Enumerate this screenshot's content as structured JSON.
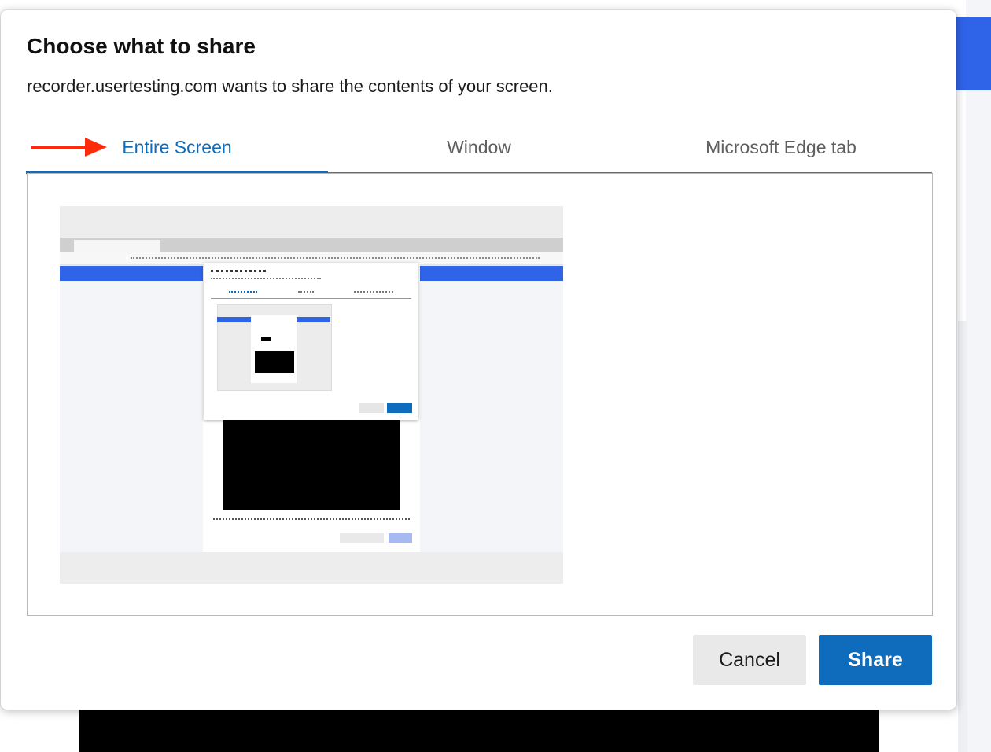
{
  "dialog": {
    "title": "Choose what to share",
    "subtitle": "recorder.usertesting.com wants to share the contents of your screen."
  },
  "tabs": [
    {
      "label": "Entire Screen",
      "active": true
    },
    {
      "label": "Window",
      "active": false
    },
    {
      "label": "Microsoft Edge tab",
      "active": false
    }
  ],
  "annotation": {
    "icon": "arrow-right-icon",
    "color": "#ff2a0a"
  },
  "preview": {
    "icon": "screen-thumbnail"
  },
  "buttons": {
    "cancel_label": "Cancel",
    "share_label": "Share"
  },
  "colors": {
    "accent": "#0f6cbd",
    "page_blue": "#2f63e8"
  }
}
